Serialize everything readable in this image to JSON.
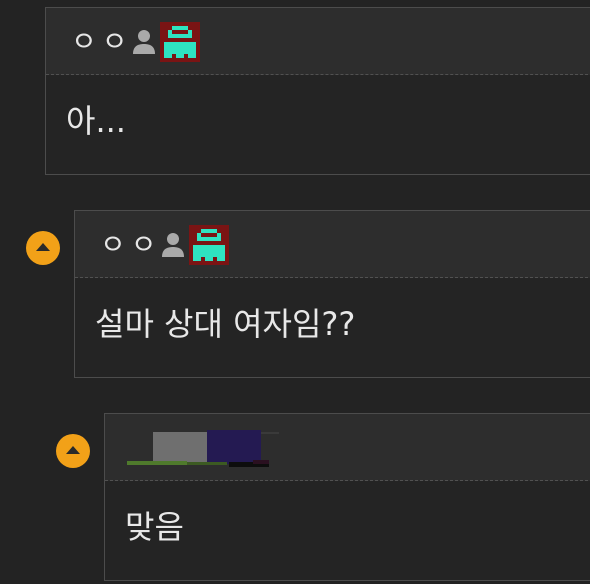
{
  "comments": [
    {
      "author": "ㅇㅇ",
      "text": "아...",
      "user_icon": "person-icon",
      "level_icon": "pixel-level-icon",
      "level_colors": {
        "background": "#7a1414",
        "figure": "#2fe3c1"
      }
    },
    {
      "author": "ㅇㅇ",
      "text": "설마 상대 여자임??",
      "user_icon": "person-icon",
      "level_icon": "pixel-level-icon",
      "level_colors": {
        "background": "#7a1414",
        "figure": "#2fe3c1"
      },
      "toggle_icon": "caret-up-icon"
    },
    {
      "author_redacted": true,
      "text": "맞음",
      "toggle_icon": "caret-up-icon"
    }
  ],
  "colors": {
    "page_background": "#232323",
    "header_background": "#2d2d2d",
    "border": "#4c4c4c",
    "text": "#e8e8e8",
    "toggle": "#f2a118"
  }
}
